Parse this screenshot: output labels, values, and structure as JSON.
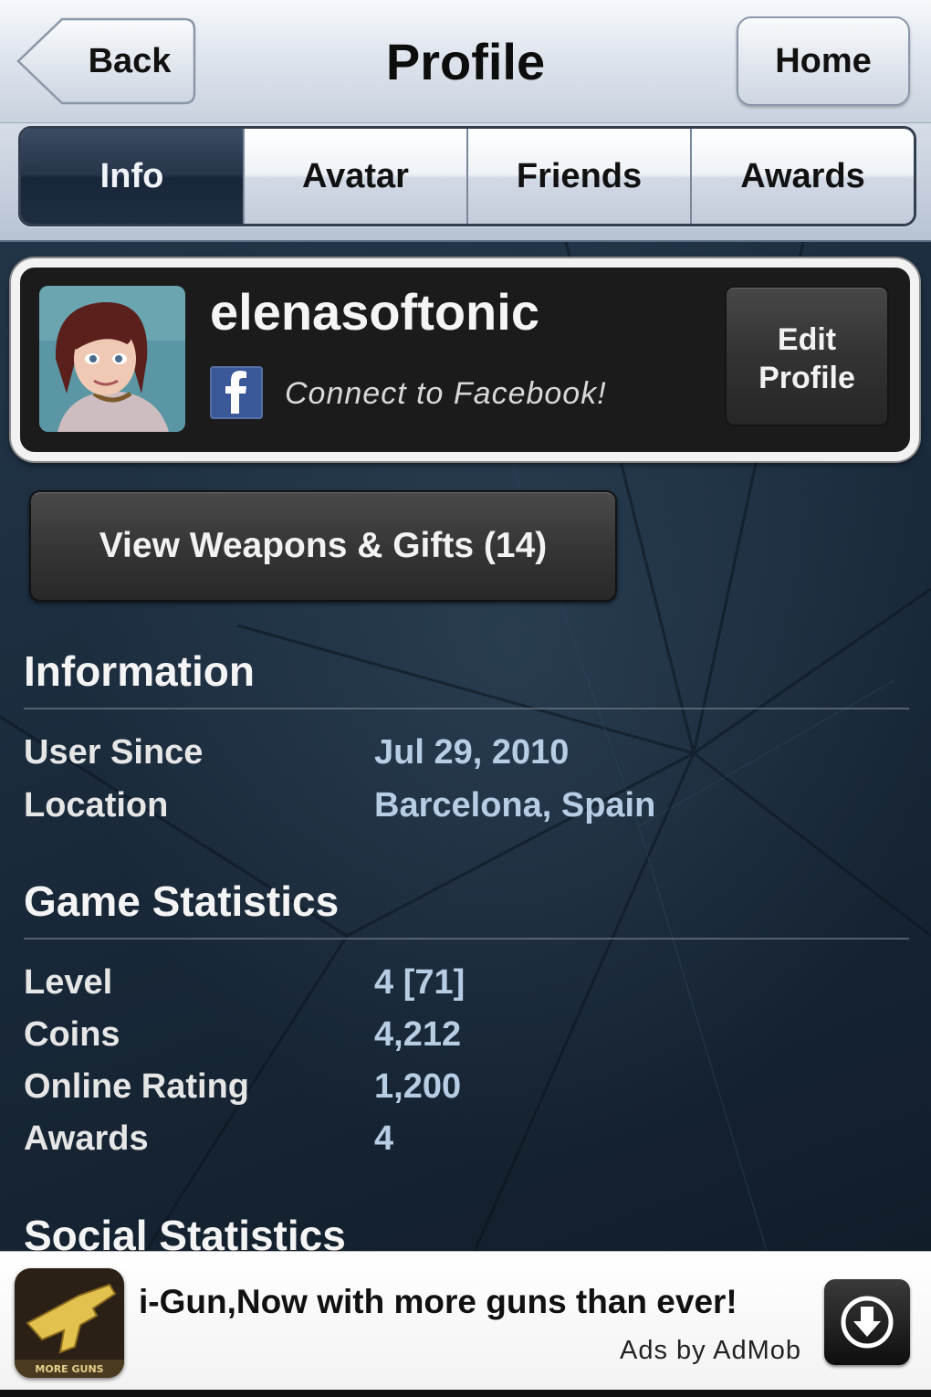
{
  "navbar": {
    "back_label": "Back",
    "title": "Profile",
    "home_label": "Home"
  },
  "tabs": [
    {
      "label": "Info",
      "active": true
    },
    {
      "label": "Avatar",
      "active": false
    },
    {
      "label": "Friends",
      "active": false
    },
    {
      "label": "Awards",
      "active": false
    }
  ],
  "profile": {
    "username": "elenasoftonic",
    "facebook_link": "Connect to Facebook!",
    "edit_line1": "Edit",
    "edit_line2": "Profile"
  },
  "weapons_button": "View Weapons & Gifts (14)",
  "information": {
    "title": "Information",
    "rows": [
      {
        "label": "User Since",
        "value": "Jul 29, 2010"
      },
      {
        "label": "Location",
        "value": "Barcelona, Spain"
      }
    ]
  },
  "game_stats": {
    "title": "Game Statistics",
    "rows": [
      {
        "label": "Level",
        "value": "4 [71]"
      },
      {
        "label": "Coins",
        "value": "4,212"
      },
      {
        "label": "Online Rating",
        "value": "1,200"
      },
      {
        "label": "Awards",
        "value": "4"
      }
    ]
  },
  "social_stats": {
    "title": "Social Statistics"
  },
  "ad": {
    "headline": "i-Gun,Now with more guns than ever!",
    "source": "Ads by AdMob",
    "icon_caption": "MORE GUNS"
  },
  "colors": {
    "facebook_blue": "#3b5998",
    "value_text": "#b7cde4",
    "active_tab": "#1f2d41"
  }
}
